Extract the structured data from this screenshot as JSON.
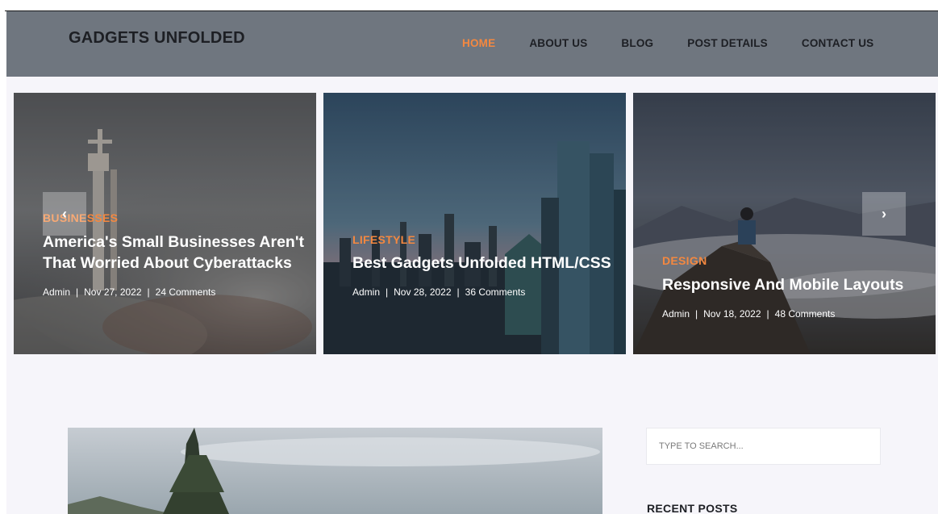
{
  "header": {
    "logo": "GADGETS UNFOLDED",
    "nav": [
      {
        "label": "HOME",
        "active": true
      },
      {
        "label": "ABOUT US",
        "active": false
      },
      {
        "label": "BLOG",
        "active": false
      },
      {
        "label": "POST DETAILS",
        "active": false
      },
      {
        "label": "CONTACT US",
        "active": false
      }
    ],
    "bg_color": "#6f767f",
    "accent_color": "#f48840"
  },
  "slider": {
    "prev_label": "‹",
    "next_label": "›",
    "slides": [
      {
        "category": "BUSINESSES",
        "title": "America's Small Businesses Aren't That Worried About Cyberattacks",
        "author": "Admin",
        "date": "Nov 27, 2022",
        "comments": "24 Comments"
      },
      {
        "category": "LIFESTYLE",
        "title": "Best Gadgets Unfolded HTML/CSS",
        "author": "Admin",
        "date": "Nov 28, 2022",
        "comments": "36 Comments"
      },
      {
        "category": "DESIGN",
        "title": "Responsive And Mobile Layouts",
        "author": "Admin",
        "date": "Nov 18, 2022",
        "comments": "48 Comments"
      }
    ],
    "separator": "|"
  },
  "sidebar": {
    "search_placeholder": "TYPE TO SEARCH...",
    "recent_posts_title": "RECENT POSTS"
  }
}
